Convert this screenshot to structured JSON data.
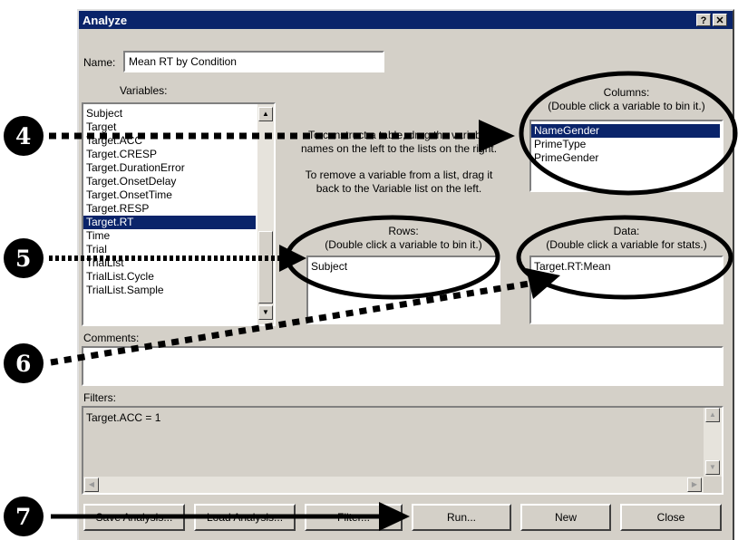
{
  "window": {
    "title": "Analyze"
  },
  "titlebar": {
    "help_label": "?",
    "close_label": "✕"
  },
  "name": {
    "label": "Name:",
    "value": "Mean RT by Condition"
  },
  "variables": {
    "label": "Variables:",
    "items": [
      "Subject",
      "Target",
      "Target.ACC",
      "Target.CRESP",
      "Target.DurationError",
      "Target.OnsetDelay",
      "Target.OnsetTime",
      "Target.RESP",
      "Target.RT",
      "Time",
      "Trial",
      "TrialList",
      "TrialList.Cycle",
      "TrialList.Sample"
    ],
    "selected": "Target.RT"
  },
  "instructions": {
    "construct": "To construct a table, drag the variable names on the left to the lists on the right.",
    "remove": "To remove a variable from a list, drag it back to the Variable list on the left."
  },
  "columns": {
    "label": "Columns:",
    "hint": "(Double click a variable to bin it.)",
    "items": [
      "NameGender",
      "PrimeType",
      "PrimeGender"
    ],
    "selected": "NameGender"
  },
  "rows": {
    "label": "Rows:",
    "hint": "(Double click a variable to bin it.)",
    "items": [
      "Subject"
    ]
  },
  "data": {
    "label": "Data:",
    "hint": "(Double click a variable for stats.)",
    "items": [
      "Target.RT:Mean"
    ]
  },
  "comments": {
    "label": "Comments:",
    "value": ""
  },
  "filters": {
    "label": "Filters:",
    "items": [
      "Target.ACC = 1"
    ]
  },
  "buttons": {
    "save": "Save Analysis...",
    "load": "Load Analysis...",
    "filter": "Filter...",
    "run": "Run...",
    "new": "New",
    "close": "Close"
  },
  "callouts": [
    "4",
    "5",
    "6",
    "7"
  ],
  "colors": {
    "selection": "#0a246a",
    "face": "#d4d0c8"
  }
}
